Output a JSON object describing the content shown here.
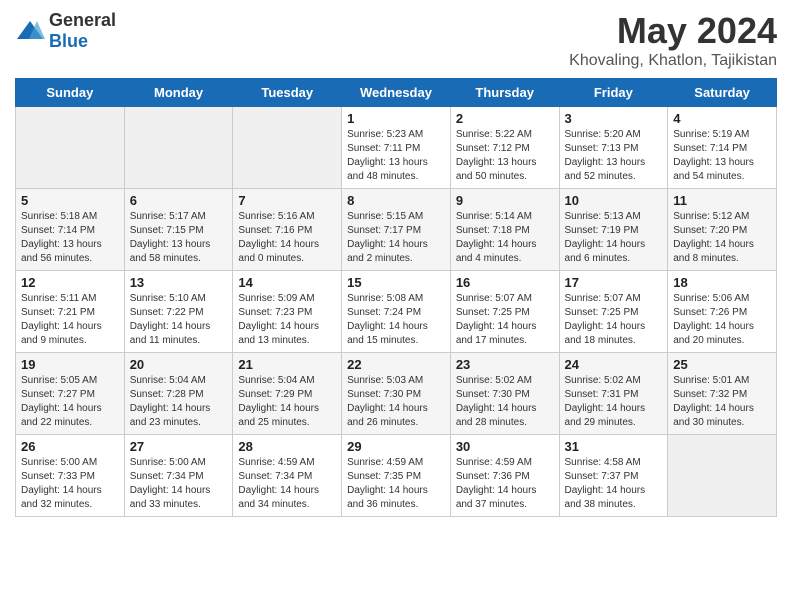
{
  "header": {
    "logo_general": "General",
    "logo_blue": "Blue",
    "month_title": "May 2024",
    "location": "Khovaling, Khatlon, Tajikistan"
  },
  "weekdays": [
    "Sunday",
    "Monday",
    "Tuesday",
    "Wednesday",
    "Thursday",
    "Friday",
    "Saturday"
  ],
  "weeks": [
    [
      {
        "day": "",
        "info": ""
      },
      {
        "day": "",
        "info": ""
      },
      {
        "day": "",
        "info": ""
      },
      {
        "day": "1",
        "info": "Sunrise: 5:23 AM\nSunset: 7:11 PM\nDaylight: 13 hours\nand 48 minutes."
      },
      {
        "day": "2",
        "info": "Sunrise: 5:22 AM\nSunset: 7:12 PM\nDaylight: 13 hours\nand 50 minutes."
      },
      {
        "day": "3",
        "info": "Sunrise: 5:20 AM\nSunset: 7:13 PM\nDaylight: 13 hours\nand 52 minutes."
      },
      {
        "day": "4",
        "info": "Sunrise: 5:19 AM\nSunset: 7:14 PM\nDaylight: 13 hours\nand 54 minutes."
      }
    ],
    [
      {
        "day": "5",
        "info": "Sunrise: 5:18 AM\nSunset: 7:14 PM\nDaylight: 13 hours\nand 56 minutes."
      },
      {
        "day": "6",
        "info": "Sunrise: 5:17 AM\nSunset: 7:15 PM\nDaylight: 13 hours\nand 58 minutes."
      },
      {
        "day": "7",
        "info": "Sunrise: 5:16 AM\nSunset: 7:16 PM\nDaylight: 14 hours\nand 0 minutes."
      },
      {
        "day": "8",
        "info": "Sunrise: 5:15 AM\nSunset: 7:17 PM\nDaylight: 14 hours\nand 2 minutes."
      },
      {
        "day": "9",
        "info": "Sunrise: 5:14 AM\nSunset: 7:18 PM\nDaylight: 14 hours\nand 4 minutes."
      },
      {
        "day": "10",
        "info": "Sunrise: 5:13 AM\nSunset: 7:19 PM\nDaylight: 14 hours\nand 6 minutes."
      },
      {
        "day": "11",
        "info": "Sunrise: 5:12 AM\nSunset: 7:20 PM\nDaylight: 14 hours\nand 8 minutes."
      }
    ],
    [
      {
        "day": "12",
        "info": "Sunrise: 5:11 AM\nSunset: 7:21 PM\nDaylight: 14 hours\nand 9 minutes."
      },
      {
        "day": "13",
        "info": "Sunrise: 5:10 AM\nSunset: 7:22 PM\nDaylight: 14 hours\nand 11 minutes."
      },
      {
        "day": "14",
        "info": "Sunrise: 5:09 AM\nSunset: 7:23 PM\nDaylight: 14 hours\nand 13 minutes."
      },
      {
        "day": "15",
        "info": "Sunrise: 5:08 AM\nSunset: 7:24 PM\nDaylight: 14 hours\nand 15 minutes."
      },
      {
        "day": "16",
        "info": "Sunrise: 5:07 AM\nSunset: 7:25 PM\nDaylight: 14 hours\nand 17 minutes."
      },
      {
        "day": "17",
        "info": "Sunrise: 5:07 AM\nSunset: 7:25 PM\nDaylight: 14 hours\nand 18 minutes."
      },
      {
        "day": "18",
        "info": "Sunrise: 5:06 AM\nSunset: 7:26 PM\nDaylight: 14 hours\nand 20 minutes."
      }
    ],
    [
      {
        "day": "19",
        "info": "Sunrise: 5:05 AM\nSunset: 7:27 PM\nDaylight: 14 hours\nand 22 minutes."
      },
      {
        "day": "20",
        "info": "Sunrise: 5:04 AM\nSunset: 7:28 PM\nDaylight: 14 hours\nand 23 minutes."
      },
      {
        "day": "21",
        "info": "Sunrise: 5:04 AM\nSunset: 7:29 PM\nDaylight: 14 hours\nand 25 minutes."
      },
      {
        "day": "22",
        "info": "Sunrise: 5:03 AM\nSunset: 7:30 PM\nDaylight: 14 hours\nand 26 minutes."
      },
      {
        "day": "23",
        "info": "Sunrise: 5:02 AM\nSunset: 7:30 PM\nDaylight: 14 hours\nand 28 minutes."
      },
      {
        "day": "24",
        "info": "Sunrise: 5:02 AM\nSunset: 7:31 PM\nDaylight: 14 hours\nand 29 minutes."
      },
      {
        "day": "25",
        "info": "Sunrise: 5:01 AM\nSunset: 7:32 PM\nDaylight: 14 hours\nand 30 minutes."
      }
    ],
    [
      {
        "day": "26",
        "info": "Sunrise: 5:00 AM\nSunset: 7:33 PM\nDaylight: 14 hours\nand 32 minutes."
      },
      {
        "day": "27",
        "info": "Sunrise: 5:00 AM\nSunset: 7:34 PM\nDaylight: 14 hours\nand 33 minutes."
      },
      {
        "day": "28",
        "info": "Sunrise: 4:59 AM\nSunset: 7:34 PM\nDaylight: 14 hours\nand 34 minutes."
      },
      {
        "day": "29",
        "info": "Sunrise: 4:59 AM\nSunset: 7:35 PM\nDaylight: 14 hours\nand 36 minutes."
      },
      {
        "day": "30",
        "info": "Sunrise: 4:59 AM\nSunset: 7:36 PM\nDaylight: 14 hours\nand 37 minutes."
      },
      {
        "day": "31",
        "info": "Sunrise: 4:58 AM\nSunset: 7:37 PM\nDaylight: 14 hours\nand 38 minutes."
      },
      {
        "day": "",
        "info": ""
      }
    ]
  ]
}
